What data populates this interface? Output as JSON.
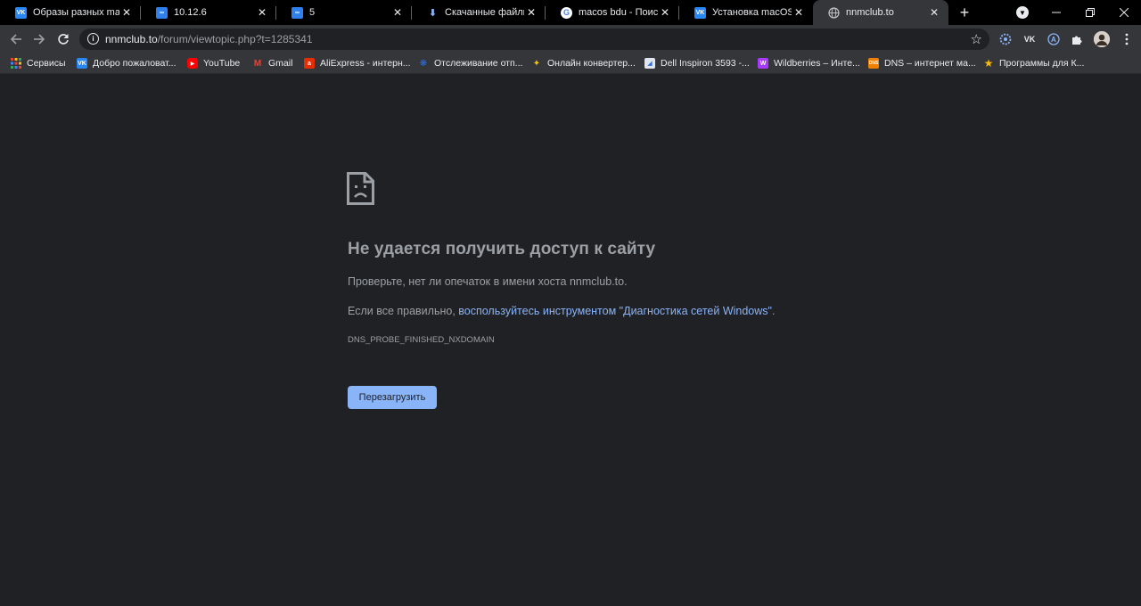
{
  "tabs": [
    {
      "title": "Образы разных macOS",
      "icon": "vk-icon",
      "color": "#2787f5",
      "glyph": "VK"
    },
    {
      "title": "10.12.6",
      "icon": "telegraph-icon",
      "color": "#2f80ed",
      "glyph": "∞"
    },
    {
      "title": "5",
      "icon": "telegraph-icon",
      "color": "#2f80ed",
      "glyph": "∞"
    },
    {
      "title": "Скачанные файлы",
      "icon": "download-icon",
      "color": "#000000",
      "glyph": "⬇"
    },
    {
      "title": "macos bdu - Поиск в",
      "icon": "google-icon",
      "color": "#ffffff",
      "glyph": "G"
    },
    {
      "title": "Установка macOS на",
      "icon": "vk-icon",
      "color": "#2787f5",
      "glyph": "VK"
    },
    {
      "title": "nnmclub.to",
      "icon": "globe-icon",
      "color": "#35363a",
      "glyph": "◍"
    }
  ],
  "toolbar": {
    "url_host": "nnmclub.to",
    "url_path": "/forum/viewtopic.php?t=1285341"
  },
  "bookmarks": [
    {
      "label": "Сервисы",
      "icon": "apps-grid-icon",
      "color": "#e37400",
      "glyph": "▦"
    },
    {
      "label": "Добро пожаловат...",
      "icon": "vk-icon",
      "color": "#2787f5",
      "glyph": "VK"
    },
    {
      "label": "YouTube",
      "icon": "youtube-icon",
      "color": "#ff0000",
      "glyph": "▶"
    },
    {
      "label": "Gmail",
      "icon": "gmail-icon",
      "color": "#35363a",
      "glyph": "M"
    },
    {
      "label": "AliExpress - интерн...",
      "icon": "aliexpress-icon",
      "color": "#e62e04",
      "glyph": "a"
    },
    {
      "label": "Отслеживание отп...",
      "icon": "tracking-icon",
      "color": "#35363a",
      "glyph": "❋"
    },
    {
      "label": "Онлайн конвертер...",
      "icon": "converter-icon",
      "color": "#35363a",
      "glyph": "✦"
    },
    {
      "label": "Dell Inspiron 3593 -...",
      "icon": "dell-icon",
      "color": "#dfe6ef",
      "glyph": "◢"
    },
    {
      "label": "Wildberries – Инте...",
      "icon": "wildberries-icon",
      "color": "#a73afd",
      "glyph": "W"
    },
    {
      "label": "DNS – интернет ма...",
      "icon": "dns-icon",
      "color": "#f08000",
      "glyph": "DNS"
    },
    {
      "label": "Программы для К...",
      "icon": "star-icon",
      "color": "#35363a",
      "glyph": "★"
    }
  ],
  "error": {
    "heading": "Не удается получить доступ к сайту",
    "line1": "Проверьте, нет ли опечаток в имени хоста nnmclub.to.",
    "line2_prefix": "Если все правильно, ",
    "line2_link": "воспользуйтесь инструментом \"Диагностика сетей Windows\"",
    "line2_suffix": ".",
    "code": "DNS_PROBE_FINISHED_NXDOMAIN",
    "reload_label": "Перезагрузить"
  },
  "colors": {
    "accent": "#8ab4f8",
    "page_bg": "#202124",
    "text": "#9aa0a6"
  }
}
